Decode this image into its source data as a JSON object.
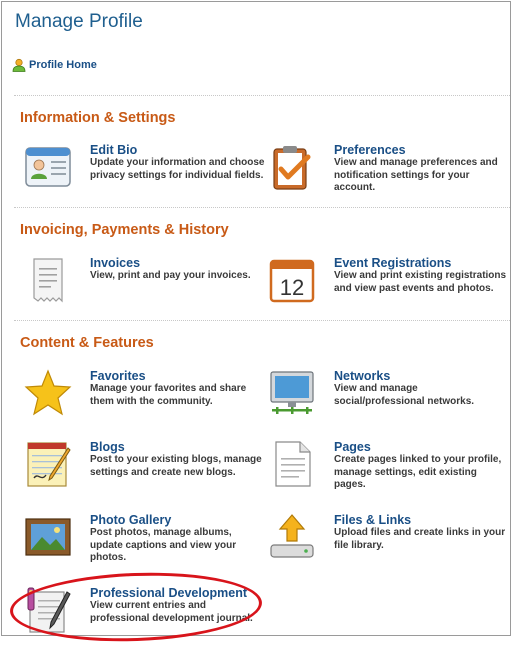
{
  "header": {
    "title": "Manage Profile"
  },
  "profile_home": {
    "label": "Profile Home"
  },
  "sections": [
    {
      "title": "Information & Settings",
      "items": [
        {
          "title": "Edit Bio",
          "desc": "Update your information and choose privacy settings for individual fields."
        },
        {
          "title": "Preferences",
          "desc": "View and manage preferences and notification settings for your account."
        }
      ]
    },
    {
      "title": "Invoicing, Payments & History",
      "items": [
        {
          "title": "Invoices",
          "desc": "View, print and pay your invoices."
        },
        {
          "title": "Event Registrations",
          "desc": "View and print existing registrations and view past events and photos."
        }
      ]
    },
    {
      "title": "Content & Features",
      "items": [
        {
          "title": "Favorites",
          "desc": "Manage your favorites and share them with the community."
        },
        {
          "title": "Networks",
          "desc": "View and manage social/professional networks."
        },
        {
          "title": "Blogs",
          "desc": "Post to your existing blogs, manage settings and create new blogs."
        },
        {
          "title": "Pages",
          "desc": "Create pages linked to your profile, manage settings, edit existing pages."
        },
        {
          "title": "Photo Gallery",
          "desc": "Post photos, manage albums, update captions and view your photos."
        },
        {
          "title": "Files & Links",
          "desc": "Upload files and create links in your file library."
        },
        {
          "title": "Professional Development",
          "desc": "View current entries and professional development journal."
        }
      ]
    }
  ],
  "calendar_icon": {
    "day": "12"
  },
  "colors": {
    "title": "#1f5f8f",
    "section": "#c85a16",
    "link": "#1a4f86",
    "highlight": "#d8141b"
  }
}
